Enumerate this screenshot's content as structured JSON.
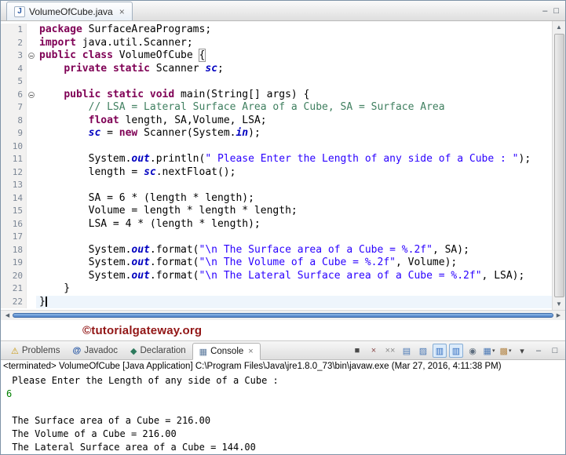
{
  "editor": {
    "tab": {
      "icon": "J",
      "title": "VolumeOfCube.java",
      "close": "×"
    },
    "minimize": "–",
    "maximize": "□",
    "scrollbar": {
      "up": "▲",
      "down": "▼",
      "left": "◀",
      "right": "▶"
    },
    "lines": [
      {
        "n": 1,
        "seg": [
          {
            "c": "kw",
            "t": "package"
          },
          {
            "c": "pl",
            "t": " SurfaceAreaPrograms;"
          }
        ]
      },
      {
        "n": 2,
        "seg": [
          {
            "c": "kw",
            "t": "import"
          },
          {
            "c": "pl",
            "t": " java.util.Scanner;"
          }
        ]
      },
      {
        "n": 3,
        "fold": true,
        "seg": [
          {
            "c": "kw",
            "t": "public"
          },
          {
            "c": "pl",
            "t": " "
          },
          {
            "c": "kw",
            "t": "class"
          },
          {
            "c": "pl",
            "t": " VolumeOfCube "
          },
          {
            "c": "pl match",
            "t": "{"
          }
        ]
      },
      {
        "n": 4,
        "seg": [
          {
            "c": "pl",
            "t": "    "
          },
          {
            "c": "kw",
            "t": "private"
          },
          {
            "c": "pl",
            "t": " "
          },
          {
            "c": "kw",
            "t": "static"
          },
          {
            "c": "pl",
            "t": " Scanner "
          },
          {
            "c": "sf",
            "t": "sc"
          },
          {
            "c": "pl",
            "t": ";"
          }
        ]
      },
      {
        "n": 5,
        "seg": []
      },
      {
        "n": 6,
        "fold": true,
        "seg": [
          {
            "c": "pl",
            "t": "    "
          },
          {
            "c": "kw",
            "t": "public"
          },
          {
            "c": "pl",
            "t": " "
          },
          {
            "c": "kw",
            "t": "static"
          },
          {
            "c": "pl",
            "t": " "
          },
          {
            "c": "kw",
            "t": "void"
          },
          {
            "c": "pl",
            "t": " main(String[] args) {"
          }
        ]
      },
      {
        "n": 7,
        "seg": [
          {
            "c": "com",
            "t": "        // LSA = Lateral Surface Area of a Cube, SA = Surface Area"
          }
        ]
      },
      {
        "n": 8,
        "seg": [
          {
            "c": "pl",
            "t": "        "
          },
          {
            "c": "kw",
            "t": "float"
          },
          {
            "c": "pl",
            "t": " length, SA,Volume, LSA;"
          }
        ]
      },
      {
        "n": 9,
        "seg": [
          {
            "c": "pl",
            "t": "        "
          },
          {
            "c": "sf",
            "t": "sc"
          },
          {
            "c": "pl",
            "t": " = "
          },
          {
            "c": "kw",
            "t": "new"
          },
          {
            "c": "pl",
            "t": " Scanner(System."
          },
          {
            "c": "sf",
            "t": "in"
          },
          {
            "c": "pl",
            "t": ");"
          }
        ]
      },
      {
        "n": 10,
        "seg": []
      },
      {
        "n": 11,
        "seg": [
          {
            "c": "pl",
            "t": "        System."
          },
          {
            "c": "sf",
            "t": "out"
          },
          {
            "c": "pl",
            "t": ".println("
          },
          {
            "c": "str",
            "t": "\" Please Enter the Length of any side of a Cube : \""
          },
          {
            "c": "pl",
            "t": ");"
          }
        ]
      },
      {
        "n": 12,
        "seg": [
          {
            "c": "pl",
            "t": "        length = "
          },
          {
            "c": "sf",
            "t": "sc"
          },
          {
            "c": "pl",
            "t": ".nextFloat();"
          }
        ]
      },
      {
        "n": 13,
        "seg": []
      },
      {
        "n": 14,
        "seg": [
          {
            "c": "pl",
            "t": "        SA = 6 * (length * length);"
          }
        ]
      },
      {
        "n": 15,
        "seg": [
          {
            "c": "pl",
            "t": "        Volume = length * length * length;"
          }
        ]
      },
      {
        "n": 16,
        "seg": [
          {
            "c": "pl",
            "t": "        LSA = 4 * (length * length);"
          }
        ]
      },
      {
        "n": 17,
        "seg": []
      },
      {
        "n": 18,
        "seg": [
          {
            "c": "pl",
            "t": "        System."
          },
          {
            "c": "sf",
            "t": "out"
          },
          {
            "c": "pl",
            "t": ".format("
          },
          {
            "c": "str",
            "t": "\"\\n The Surface area of a Cube = %.2f\""
          },
          {
            "c": "pl",
            "t": ", SA);"
          }
        ]
      },
      {
        "n": 19,
        "seg": [
          {
            "c": "pl",
            "t": "        System."
          },
          {
            "c": "sf",
            "t": "out"
          },
          {
            "c": "pl",
            "t": ".format("
          },
          {
            "c": "str",
            "t": "\"\\n The Volume of a Cube = %.2f\""
          },
          {
            "c": "pl",
            "t": ", Volume);"
          }
        ]
      },
      {
        "n": 20,
        "seg": [
          {
            "c": "pl",
            "t": "        System."
          },
          {
            "c": "sf",
            "t": "out"
          },
          {
            "c": "pl",
            "t": ".format("
          },
          {
            "c": "str",
            "t": "\"\\n The Lateral Surface area of a Cube = %.2f\""
          },
          {
            "c": "pl",
            "t": ", LSA);"
          }
        ]
      },
      {
        "n": 21,
        "seg": [
          {
            "c": "pl",
            "t": "    }"
          }
        ]
      },
      {
        "n": 22,
        "cursor": true,
        "seg": [
          {
            "c": "pl",
            "t": "}"
          }
        ]
      }
    ]
  },
  "watermark": "©tutorialgateway.org",
  "console": {
    "tabs": [
      {
        "icon": "⚠",
        "label": "Problems"
      },
      {
        "icon": "@",
        "label": "Javadoc"
      },
      {
        "icon": "◆",
        "label": "Declaration"
      },
      {
        "icon": "▦",
        "label": "Console",
        "close": "×",
        "active": true
      }
    ],
    "toolbar": [
      {
        "name": "terminate-icon",
        "glyph": "■",
        "color": "#4a4a4a"
      },
      {
        "name": "remove-launch-icon",
        "glyph": "×",
        "color": "#8a4a4a"
      },
      {
        "name": "remove-all-terminated-icon",
        "glyph": "××",
        "color": "#8a8a8a"
      },
      {
        "name": "scroll-lock-icon",
        "glyph": "▤",
        "color": "#4a78b5"
      },
      {
        "name": "clear-console-icon",
        "glyph": "▨",
        "color": "#4a78b5"
      },
      {
        "name": "show-stdout-icon",
        "glyph": "▥",
        "color": "#2f6bbf",
        "active": true
      },
      {
        "name": "show-stderr-icon",
        "glyph": "▥",
        "color": "#2f6bbf",
        "active": true
      },
      {
        "name": "pin-console-icon",
        "glyph": "◉",
        "color": "#5d6d7e"
      },
      {
        "name": "display-console-icon",
        "glyph": "▦",
        "color": "#4a78b5",
        "dropdown": "▾"
      },
      {
        "name": "open-console-icon",
        "glyph": "▩",
        "color": "#b5884a",
        "dropdown": "▾"
      },
      {
        "name": "view-menu-icon",
        "glyph": "▾",
        "color": "#444444"
      },
      {
        "name": "minimize-view-icon",
        "glyph": "–",
        "color": "#44505c"
      },
      {
        "name": "maximize-view-icon",
        "glyph": "□",
        "color": "#44505c"
      }
    ],
    "status": "<terminated> VolumeOfCube [Java Application] C:\\Program Files\\Java\\jre1.8.0_73\\bin\\javaw.exe (Mar 27, 2016, 4:11:38 PM)",
    "output": [
      {
        "c": "out",
        "t": " Please Enter the Length of any side of a Cube : "
      },
      {
        "c": "in",
        "t": "6"
      },
      {
        "c": "out",
        "t": ""
      },
      {
        "c": "out",
        "t": " The Surface area of a Cube = 216.00"
      },
      {
        "c": "out",
        "t": " The Volume of a Cube = 216.00"
      },
      {
        "c": "out",
        "t": " The Lateral Surface area of a Cube = 144.00"
      }
    ]
  }
}
